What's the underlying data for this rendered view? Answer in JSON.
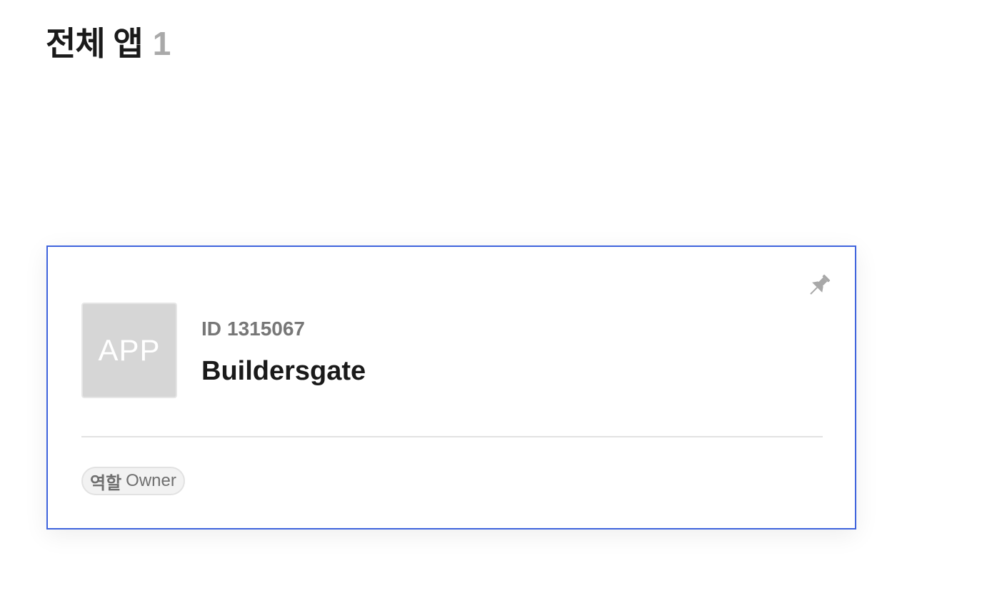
{
  "header": {
    "title": "전체 앱",
    "count": "1"
  },
  "apps": [
    {
      "thumbnail_text": "APP",
      "id_label": "ID",
      "id_value": "1315067",
      "name": "Buildersgate",
      "role_label": "역할",
      "role_value": "Owner",
      "pin_icon": "pin-icon"
    }
  ],
  "colors": {
    "accent": "#3e63dd",
    "muted": "#a9a9a9",
    "thumbnail": "#d6d6d6"
  }
}
